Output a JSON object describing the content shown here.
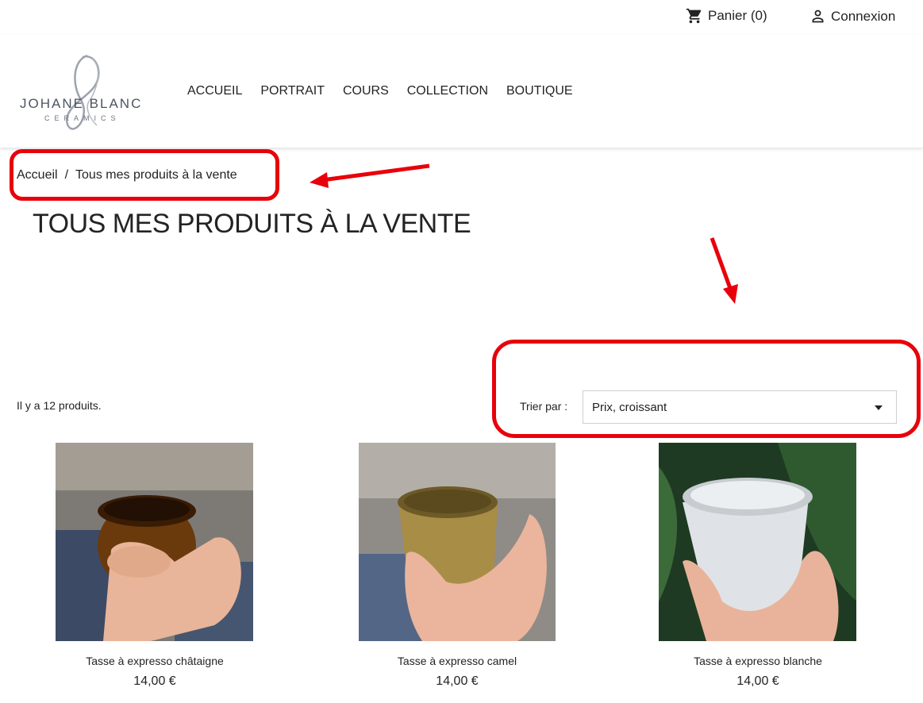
{
  "topbar": {
    "cart_label": "Panier (0)",
    "login_label": "Connexion"
  },
  "logo": {
    "main": "JOHANE BLANC",
    "sub": "CERAMICS"
  },
  "nav": {
    "items": [
      "ACCUEIL",
      "PORTRAIT",
      "COURS",
      "COLLECTION",
      "BOUTIQUE"
    ]
  },
  "breadcrumb": {
    "home": "Accueil",
    "separator": "/",
    "current": "Tous mes produits à la vente"
  },
  "page": {
    "title": "TOUS MES PRODUITS À LA VENTE",
    "product_count": "Il y a 12 produits."
  },
  "sort": {
    "label": "Trier par :",
    "selected": "Prix, croissant"
  },
  "products": [
    {
      "name": "Tasse à expresso châtaigne",
      "price": "14,00 €"
    },
    {
      "name": "Tasse à expresso camel",
      "price": "14,00 €"
    },
    {
      "name": "Tasse à expresso blanche",
      "price": "14,00 €"
    }
  ],
  "colors": {
    "annotation": "#e8000b",
    "text": "#232323"
  },
  "icons": [
    "cart-icon",
    "user-icon",
    "caret-down-icon"
  ]
}
